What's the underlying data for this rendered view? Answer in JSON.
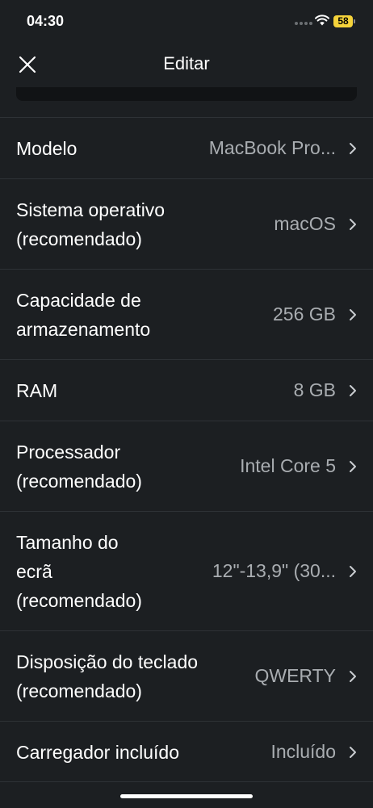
{
  "status_bar": {
    "time": "04:30",
    "battery": "58"
  },
  "header": {
    "title": "Editar",
    "close_icon": "close-icon"
  },
  "rows": [
    {
      "label": "Modelo",
      "value": "MacBook Pro..."
    },
    {
      "label": "Sistema operativo\n(recomendado)",
      "value": "macOS"
    },
    {
      "label": "Capacidade de\narmazenamento",
      "value": "256 GB"
    },
    {
      "label": "RAM",
      "value": "8 GB"
    },
    {
      "label": "Processador\n(recomendado)",
      "value": "Intel Core 5"
    },
    {
      "label": "Tamanho do\necrã\n(recomendado)",
      "value": "12\"-13,9\" (30..."
    },
    {
      "label": "Disposição do teclado\n(recomendado)",
      "value": "QWERTY"
    },
    {
      "label": "Carregador incluído",
      "value": "Incluído"
    }
  ]
}
